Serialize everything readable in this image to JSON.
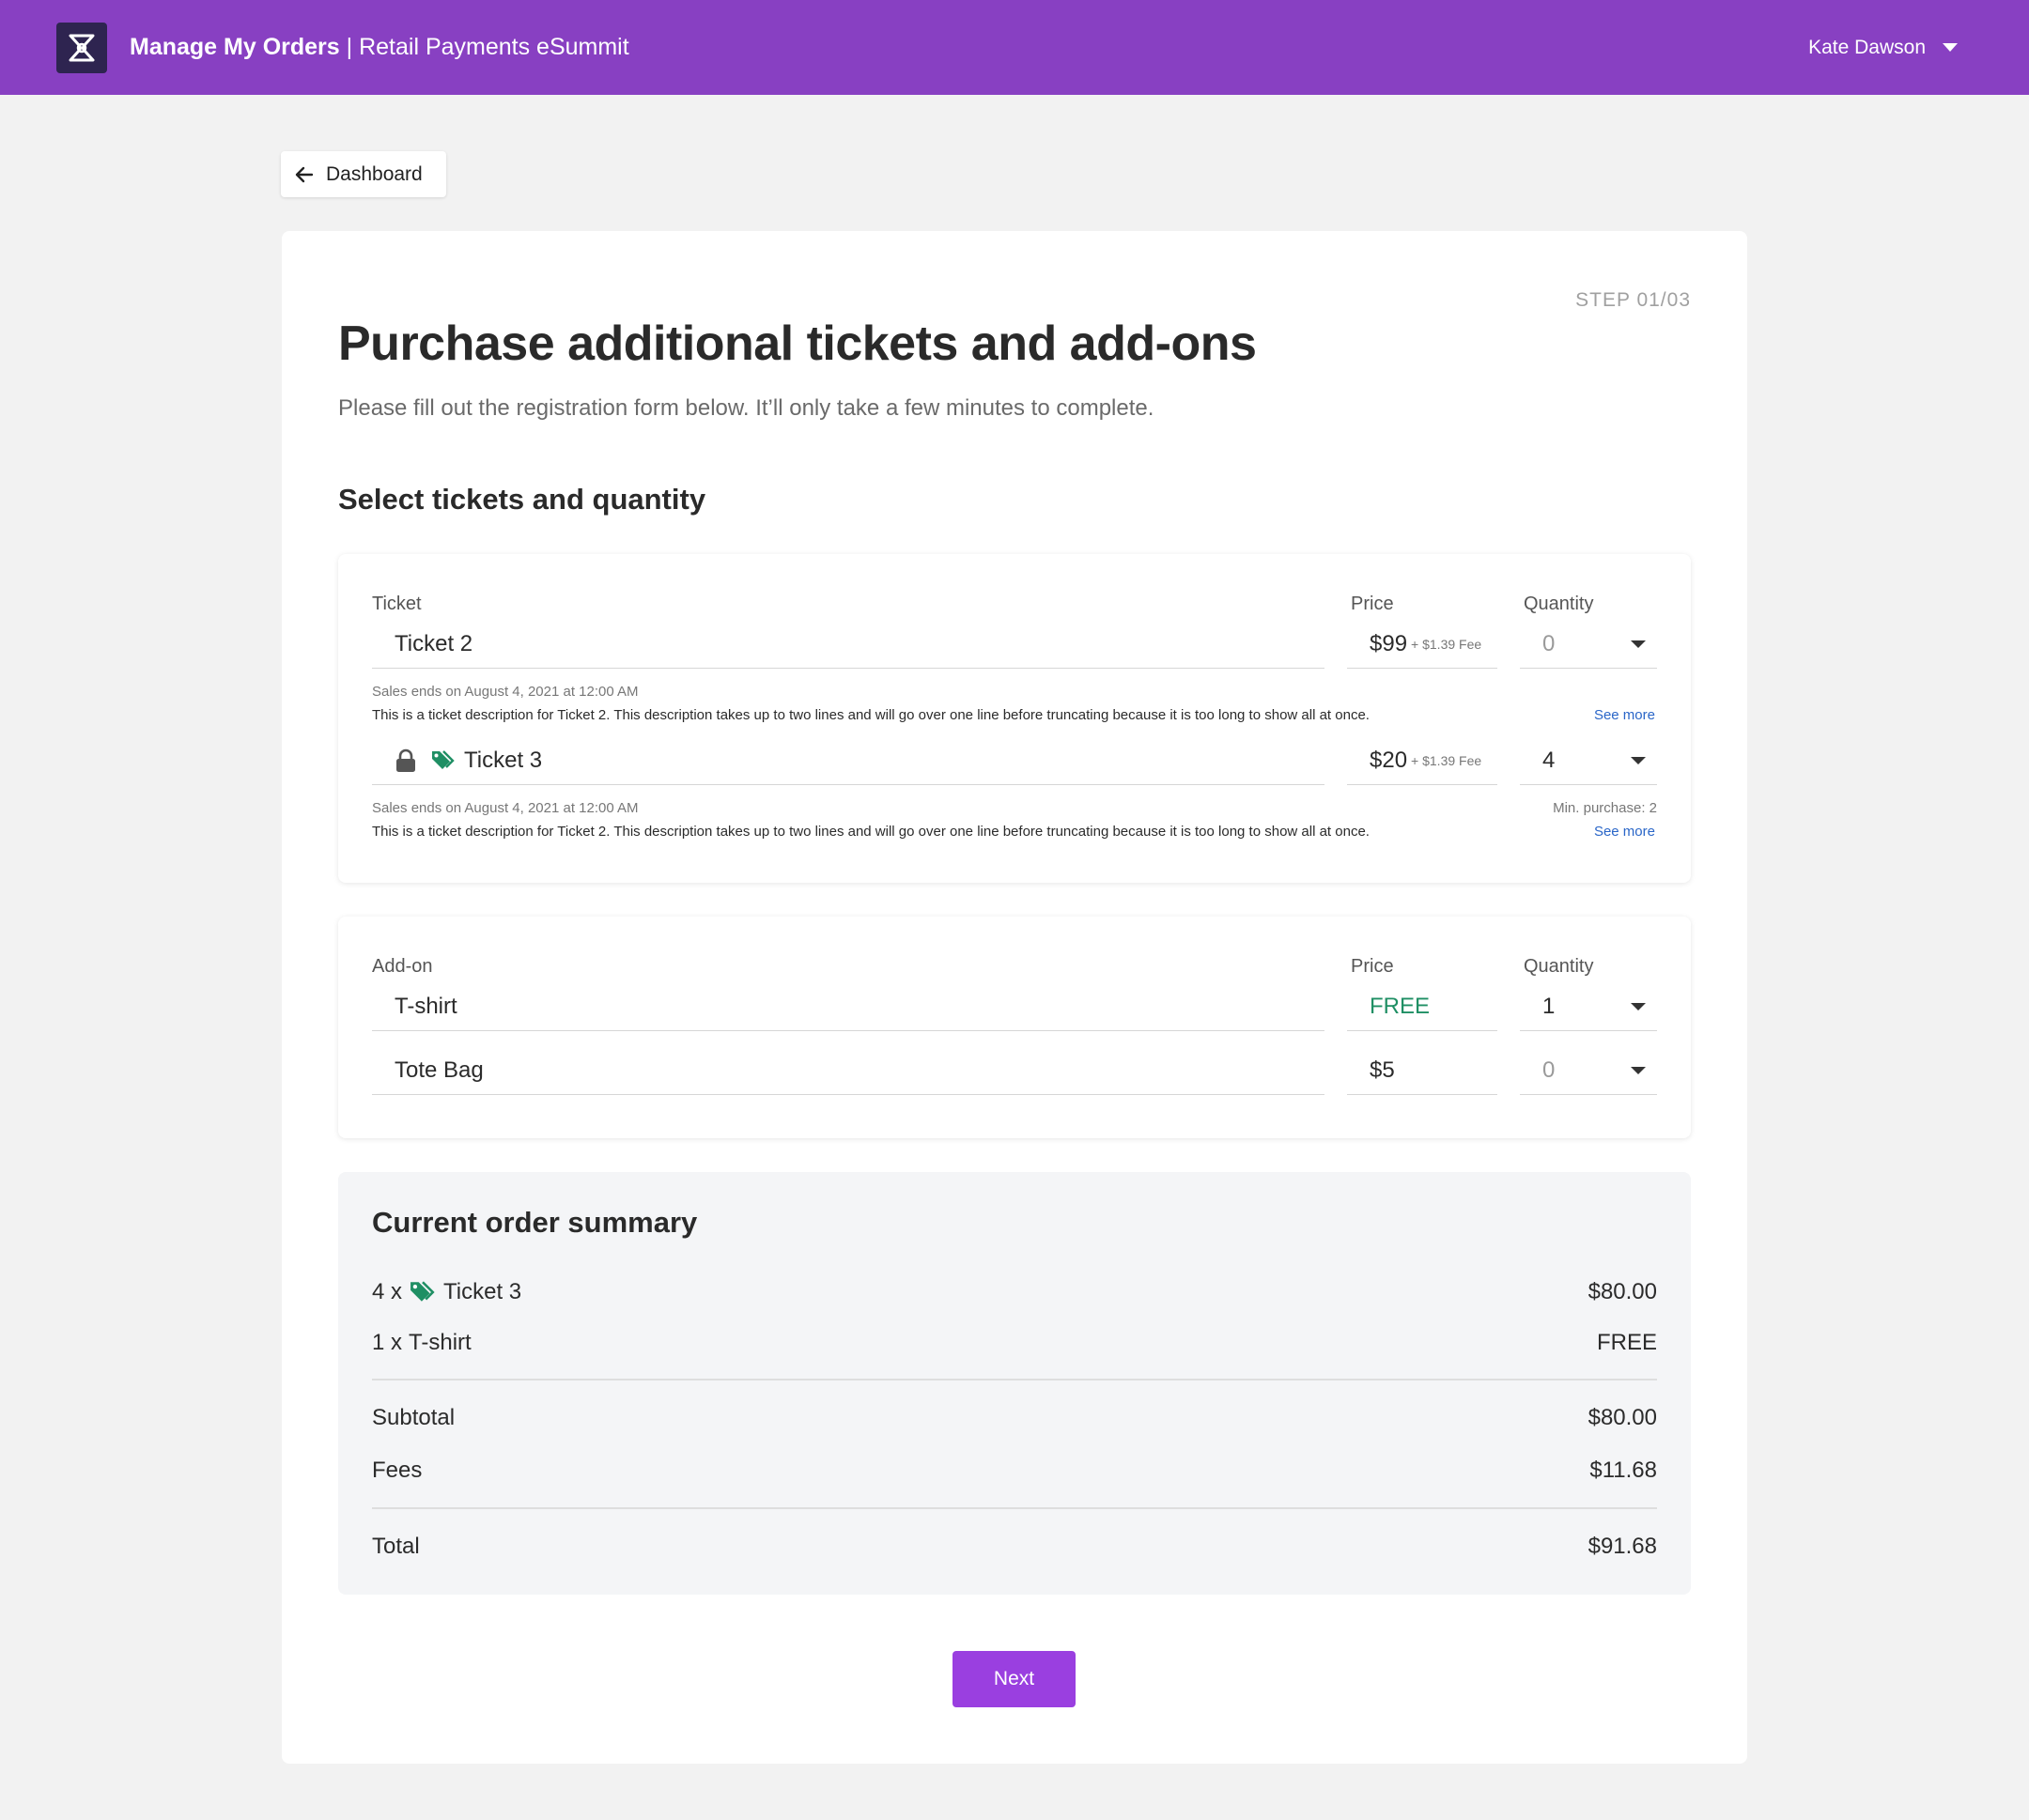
{
  "header": {
    "app_name": "Manage My Orders",
    "separator": " | ",
    "event_name": "Retail Payments eSummit",
    "user_name": "Kate Dawson"
  },
  "nav": {
    "back_label": "Dashboard"
  },
  "page": {
    "step": "STEP 01/03",
    "title": "Purchase additional tickets and add-ons",
    "subtitle": "Please fill out the registration form below. It’ll only take a few minutes to complete.",
    "section_title": "Select tickets and quantity"
  },
  "tickets": {
    "col_ticket": "Ticket",
    "col_price": "Price",
    "col_quantity": "Quantity",
    "items": [
      {
        "name": "Ticket 2",
        "price": "$99",
        "fee": "+ $1.39 Fee",
        "quantity": "0",
        "sales_end": "Sales ends on August 4, 2021 at 12:00 AM",
        "description": "This is a ticket description for Ticket 2. This description takes up to two lines and will go over one line before truncating because it is too long to show all at once.",
        "see_more": "See more"
      },
      {
        "name": "Ticket 3",
        "price": "$20",
        "fee": "+ $1.39 Fee",
        "quantity": "4",
        "min_purchase": "Min. purchase: 2",
        "sales_end": "Sales ends on August 4, 2021 at 12:00 AM",
        "description": "This is a ticket description for Ticket 2. This description takes up to two lines and will go over one line before truncating because it is too long to show all at once.",
        "see_more": "See more"
      }
    ]
  },
  "addons": {
    "col_addon": "Add-on",
    "col_price": "Price",
    "col_quantity": "Quantity",
    "items": [
      {
        "name": "T-shirt",
        "price": "FREE",
        "quantity": "1"
      },
      {
        "name": "Tote Bag",
        "price": "$5",
        "quantity": "0"
      }
    ]
  },
  "summary": {
    "title": "Current order summary",
    "lines": [
      {
        "qty": "4 x",
        "name": "Ticket 3",
        "amount": "$80.00"
      },
      {
        "qty": "1 x",
        "name": "T-shirt",
        "amount": "FREE"
      }
    ],
    "subtotal_label": "Subtotal",
    "subtotal": "$80.00",
    "fees_label": "Fees",
    "fees": "$11.68",
    "total_label": "Total",
    "total": "$91.68"
  },
  "actions": {
    "next_label": "Next"
  },
  "colors": {
    "header_bg": "#8840c2",
    "accent_button": "#9a3fe0",
    "free_green": "#1f8f64",
    "link_blue": "#2a66c8"
  },
  "icons": {
    "logo": "event-logo-icon",
    "back": "arrow-left-icon",
    "user_dropdown": "caret-down-icon",
    "lock": "lock-icon",
    "promo": "tag-icon"
  }
}
